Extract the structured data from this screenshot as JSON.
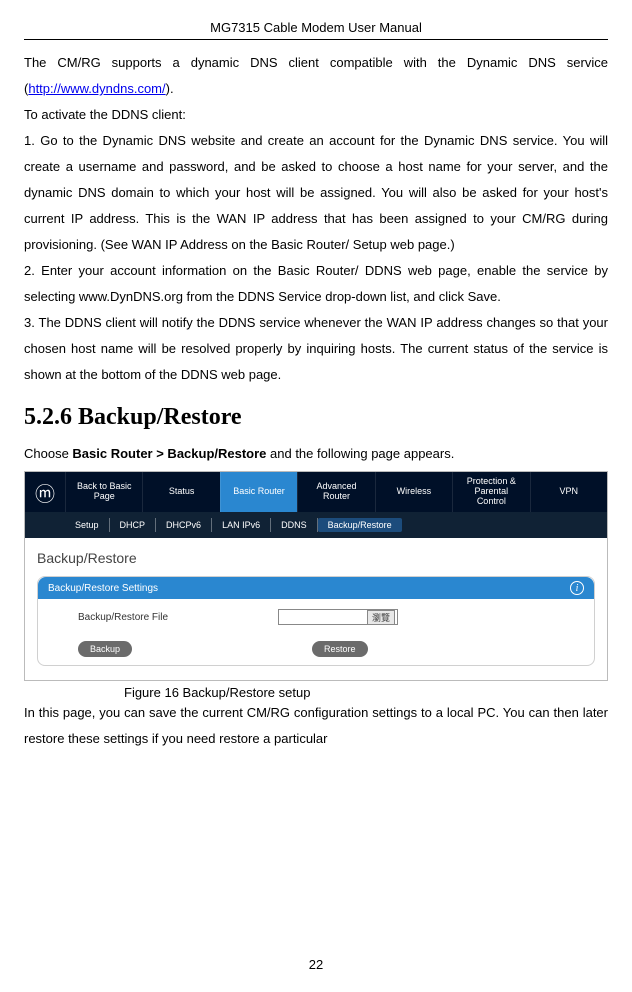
{
  "header": {
    "title": "MG7315 Cable Modem User Manual"
  },
  "content": {
    "p1_a": "The CM/RG supports a dynamic DNS client compatible with the Dynamic DNS service (",
    "p1_link": "http://www.dyndns.com/",
    "p1_b": ").",
    "p2": "To activate the DDNS client:",
    "p3": "1.  Go to the Dynamic DNS website and create an account for the Dynamic DNS service.  You will create a username and password, and be asked to choose a host name for your server, and the dynamic DNS domain to which your host will be assigned.  You will also be asked for your host's current IP address. This is the WAN IP address that has been assigned to your CM/RG during provisioning. (See WAN IP Address on the Basic Router/ Setup web page.)",
    "p4": "2.  Enter your account information on the Basic Router/ DDNS web page, enable the service by selecting www.DynDNS.org from the DDNS Service drop-down list, and click Save.",
    "p5": "3.  The DDNS client will notify the DDNS service whenever the WAN IP address changes so that your chosen host name will be resolved properly by inquiring hosts. The current status of the service is shown at the bottom of the DDNS web page.",
    "heading": "5.2.6  Backup/Restore",
    "choose_a": "Choose ",
    "choose_b": "Basic Router > Backup/Restore",
    "choose_c": " and the following page appears.",
    "caption": "Figure 16 Backup/Restore setup",
    "p6": "In this page, you can save the current CM/RG configuration settings to a local PC. You can then later restore these settings if you need restore a particular"
  },
  "router_ui": {
    "nav": {
      "logo": "ⓜ",
      "items": [
        {
          "label": "Back to Basic Page"
        },
        {
          "label": "Status"
        },
        {
          "label": "Basic Router",
          "active": true
        },
        {
          "label": "Advanced Router"
        },
        {
          "label": "Wireless"
        },
        {
          "label": "Protection & Parental Control"
        },
        {
          "label": "VPN"
        }
      ]
    },
    "subnav": [
      "Setup",
      "DHCP",
      "DHCPv6",
      "LAN IPv6",
      "DDNS",
      "Backup/Restore"
    ],
    "subnav_active_index": 5,
    "panel": {
      "page_title": "Backup/Restore",
      "head": "Backup/Restore Settings",
      "row_label": "Backup/Restore File",
      "browse": "瀏覽",
      "btn_backup": "Backup",
      "btn_restore": "Restore"
    }
  },
  "footer": {
    "page_number": "22"
  }
}
